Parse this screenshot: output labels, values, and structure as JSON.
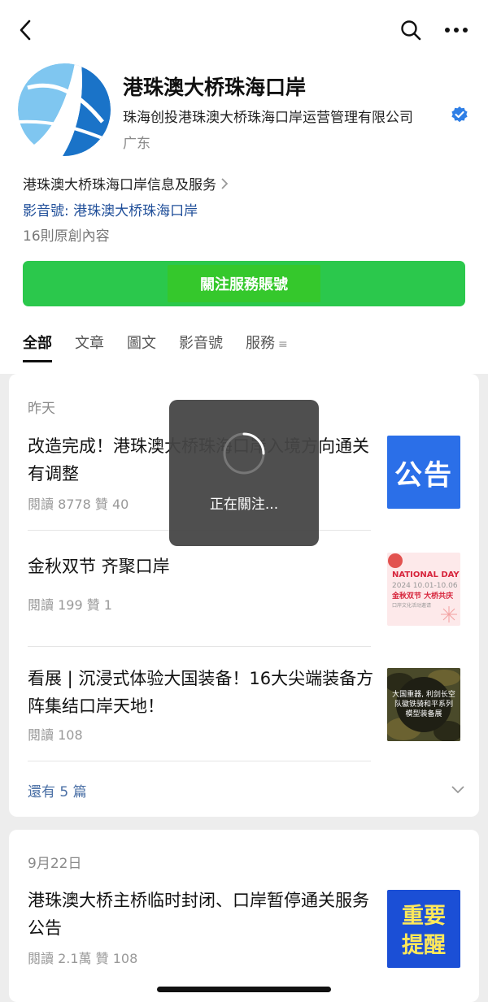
{
  "nav": {
    "back_icon": "chevron-left-icon",
    "search_icon": "search-icon",
    "more_icon": "more-horizontal-icon"
  },
  "profile": {
    "name": "港珠澳大桥珠海口岸",
    "company": "珠海创投港珠澳大桥珠海口岸运营管理有限公司",
    "region": "广东",
    "description": "港珠澳大桥珠海口岸信息及服务",
    "video_label": "影音號: 港珠澳大桥珠海口岸",
    "original_count": "16則原創內容",
    "brand_color": "#1a73c8",
    "verified_color": "#2f7fe6"
  },
  "follow_button": {
    "label": "關注服務賬號",
    "color": "#2bc84c"
  },
  "tabs": [
    {
      "label": "全部",
      "active": true
    },
    {
      "label": "文章",
      "active": false
    },
    {
      "label": "圖文",
      "active": false
    },
    {
      "label": "影音號",
      "active": false
    },
    {
      "label": "服務",
      "active": false,
      "menu_glyph": "≡"
    }
  ],
  "groups": [
    {
      "date": "昨天",
      "articles": [
        {
          "title": "改造完成！港珠澳大桥珠海口岸入境方向通关有调整",
          "meta": "閱讀 8778  贊 40",
          "thumb_text": "公告"
        },
        {
          "title": "金秋双节 齐聚口岸",
          "meta": "閱讀 199  贊 1",
          "thumb_title": "NATIONAL DAY",
          "thumb_date": "2024 10.01-10.06",
          "thumb_slogan": "金秋双节 大桥共庆",
          "thumb_footer": "口岸文化活动邀请"
        },
        {
          "title": "看展 | 沉浸式体验大国装备！16大尖端装备方阵集结口岸天地！",
          "meta": "閱讀 108",
          "thumb_text": "大国重器, 利剑长空 队徽铁骑和平系列模型装备展"
        }
      ],
      "more_label": "還有 5 篇"
    },
    {
      "date": "9月22日",
      "articles": [
        {
          "title": "港珠澳大桥主桥临时封闭、口岸暂停通关服务公告",
          "meta": "閱讀 2.1萬  贊 108",
          "thumb_line1": "重要",
          "thumb_line2": "提醒"
        }
      ]
    }
  ],
  "toast": {
    "text": "正在關注..."
  }
}
